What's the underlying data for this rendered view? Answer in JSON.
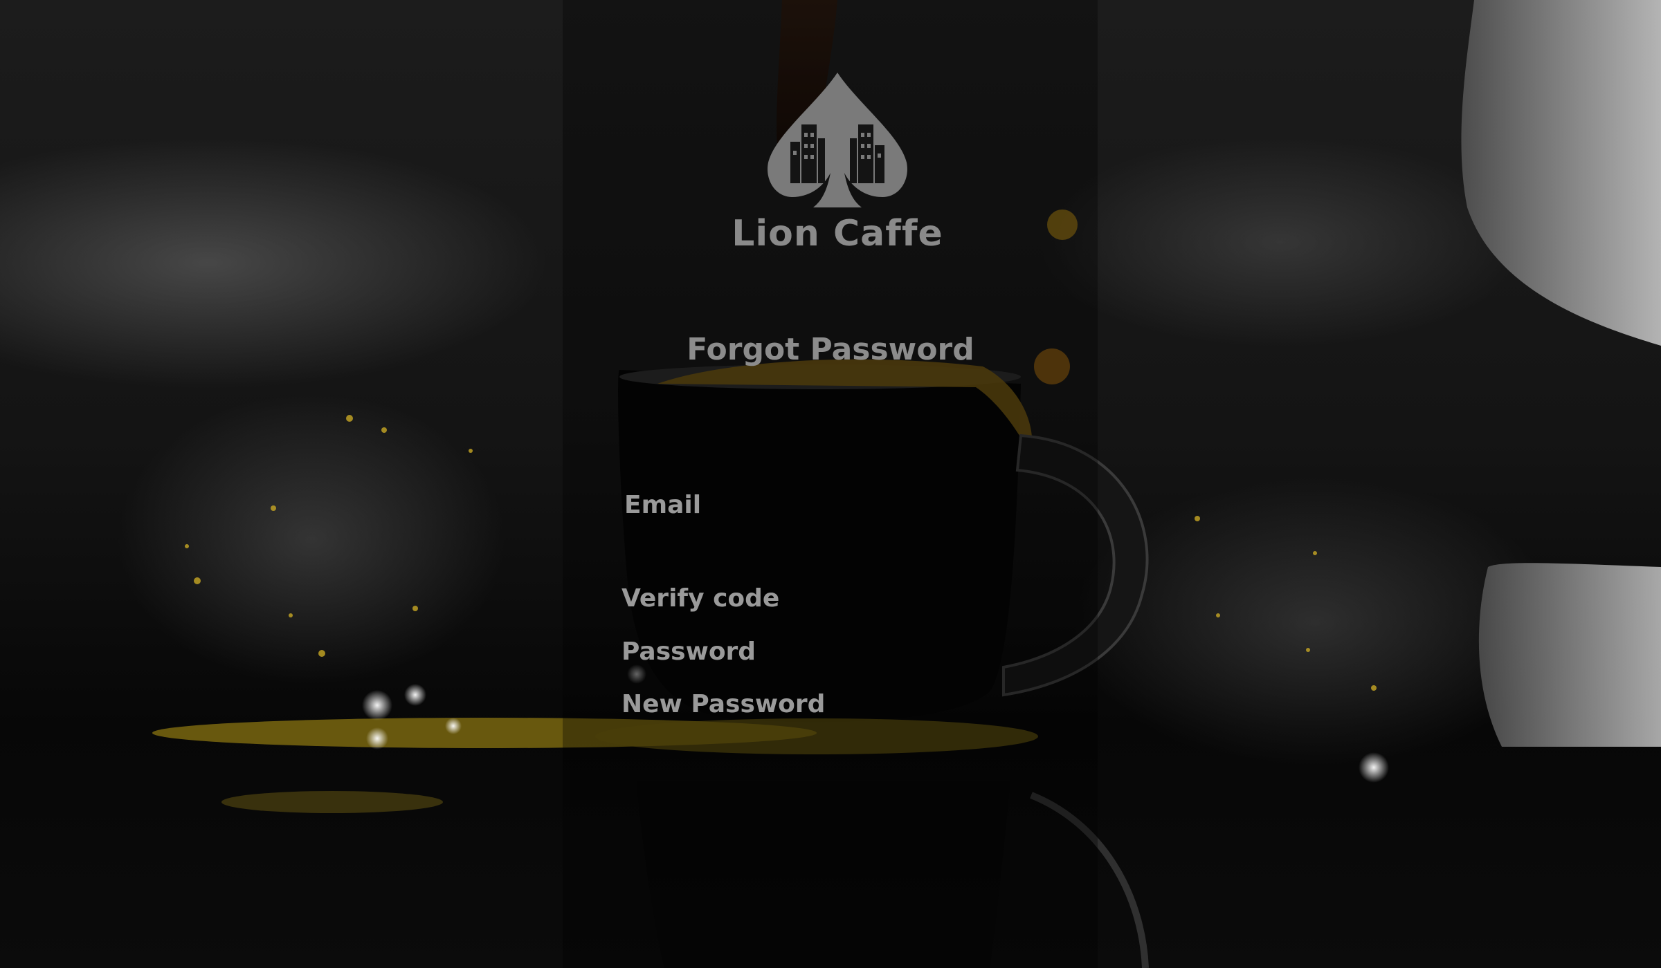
{
  "brand": {
    "name": "Lion Caffe",
    "logo_icon": "spade-city-skyline-icon"
  },
  "form": {
    "title": "Forgot Password",
    "fields": {
      "email": {
        "label": "Email",
        "value": ""
      },
      "verify_code": {
        "label": "Verify code",
        "value": ""
      },
      "password": {
        "label": "Password",
        "value": ""
      },
      "new_password": {
        "label": "New Password",
        "value": ""
      }
    }
  },
  "colors": {
    "text_gray": "#9a9a9a",
    "coffee_gold": "#b89a18",
    "panel_overlay": "#000000"
  }
}
